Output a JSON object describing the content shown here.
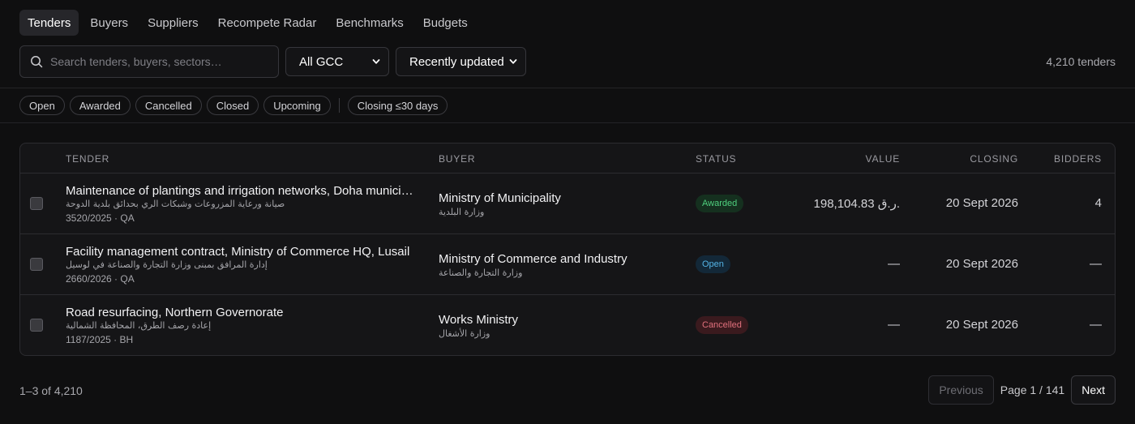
{
  "nav": {
    "tabs": [
      {
        "label": "Tenders",
        "active": true
      },
      {
        "label": "Buyers"
      },
      {
        "label": "Suppliers"
      },
      {
        "label": "Recompete Radar"
      },
      {
        "label": "Benchmarks"
      },
      {
        "label": "Budgets"
      }
    ]
  },
  "toolbar": {
    "search_placeholder": "Search tenders, buyers, sectors…",
    "region_selected": "All GCC",
    "sort_selected": "Recently updated",
    "count": "4,210 tenders"
  },
  "filters": {
    "status_chips": [
      "Open",
      "Awarded",
      "Cancelled",
      "Closed",
      "Upcoming"
    ],
    "closing_chip": "Closing ≤30 days"
  },
  "table": {
    "columns": {
      "tender": "TENDER",
      "buyer": "BUYER",
      "status": "STATUS",
      "value": "VALUE",
      "closing": "CLOSING",
      "bidders": "BIDDERS"
    },
    "rows": [
      {
        "title": "Maintenance of plantings and irrigation networks, Doha municipality",
        "title_ar": "صيانة ورعاية المزروعات وشبكات الري بحدائق بلدية الدوحة",
        "ref": "3520/2025 · QA",
        "buyer": "Ministry of Municipality",
        "buyer_ar": "وزارة البلدية",
        "status": "Awarded",
        "value": "198,104.83 ر.ق.",
        "closing": "20 Sept 2026",
        "bidders": "4"
      },
      {
        "title": "Facility management contract, Ministry of Commerce HQ, Lusail",
        "title_ar": "إدارة المرافق بمبنى وزارة التجارة والصناعة في لوسيل",
        "ref": "2660/2026 · QA",
        "buyer": "Ministry of Commerce and Industry",
        "buyer_ar": "وزارة التجارة والصناعة",
        "status": "Open",
        "value": "—",
        "closing": "20 Sept 2026",
        "bidders": "—"
      },
      {
        "title": "Road resurfacing, Northern Governorate",
        "title_ar": "إعادة رصف الطرق، المحافظة الشمالية",
        "ref": "1187/2025 · BH",
        "buyer": "Works Ministry",
        "buyer_ar": "وزارة الأشغال",
        "status": "Cancelled",
        "value": "—",
        "closing": "20 Sept 2026",
        "bidders": "—"
      }
    ]
  },
  "footer": {
    "range": "1–3 of 4,210",
    "previous_label": "Previous",
    "page_info": "Page 1 / 141",
    "next_label": "Next"
  },
  "colors": {
    "background": "#0f0f10",
    "awarded": "#4fcf7e",
    "open": "#54b4e6",
    "cancelled": "#e0707c"
  }
}
